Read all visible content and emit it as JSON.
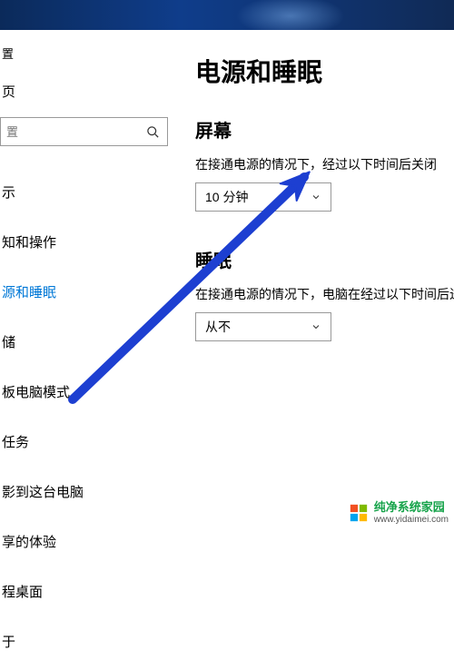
{
  "window": {
    "settings_label": "置",
    "home_label": "页",
    "search_placeholder": "置"
  },
  "sidebar": {
    "items": [
      {
        "label": "示"
      },
      {
        "label": "知和操作"
      },
      {
        "label": "源和睡眠"
      },
      {
        "label": "储"
      },
      {
        "label": "板电脑模式"
      },
      {
        "label": "任务"
      },
      {
        "label": "影到这台电脑"
      },
      {
        "label": "享的体验"
      },
      {
        "label": "程桌面"
      },
      {
        "label": "于"
      }
    ],
    "active_index": 2
  },
  "main": {
    "title": "电源和睡眠",
    "screen": {
      "heading": "屏幕",
      "desc": "在接通电源的情况下，经过以下时间后关闭",
      "value": "10 分钟"
    },
    "sleep": {
      "heading": "睡眠",
      "desc": "在接通电源的情况下，电脑在经过以下时间后进入睡眠",
      "value": "从不"
    }
  },
  "watermark": {
    "line1": "纯净系统家园",
    "line2": "www.yidaimei.com"
  }
}
